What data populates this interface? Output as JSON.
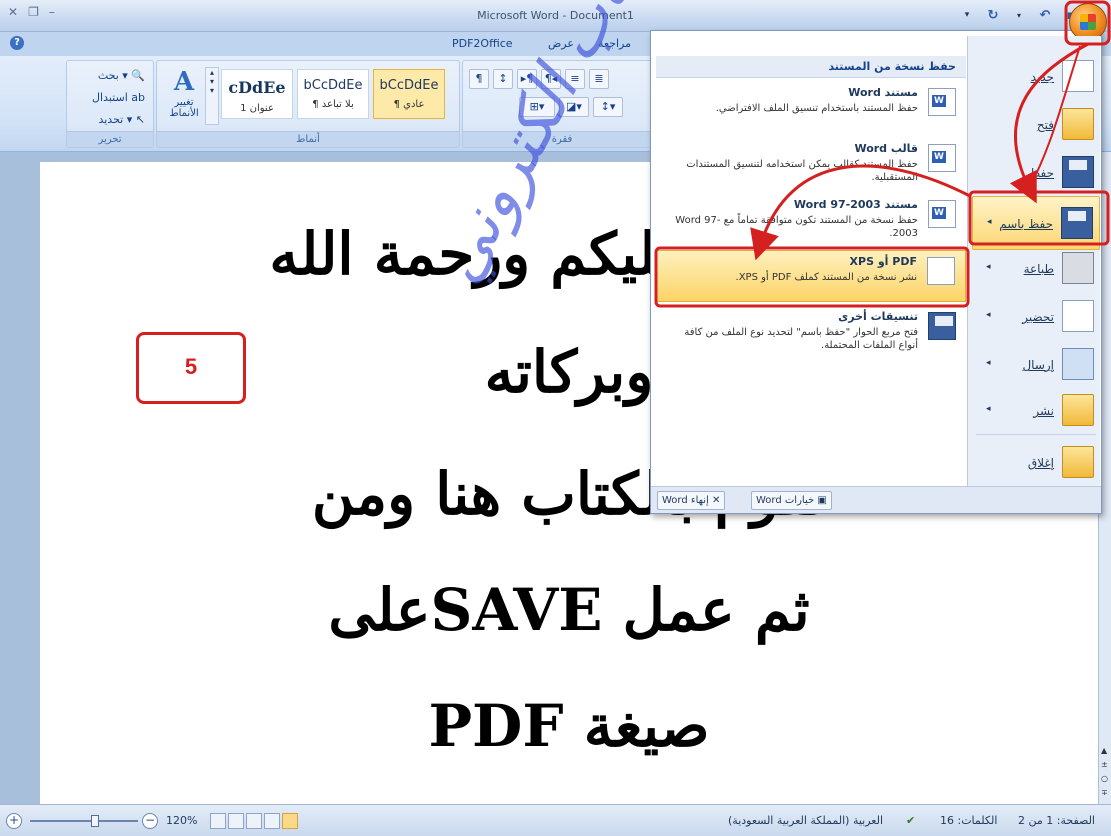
{
  "window": {
    "title": "Microsoft Word - Document1"
  },
  "ribbon": {
    "tabs": [
      "PDF2Office",
      "عرض",
      "مراجعة"
    ],
    "editing_group": {
      "label": "تحرير",
      "find": "بحث",
      "replace": "استبدال",
      "select": "تحديد"
    },
    "styles_group": {
      "label": "أنماط",
      "change_styles": "تغيير الأنماط",
      "styles": [
        {
          "sample": "cDdEe",
          "name": "عنوان 1"
        },
        {
          "sample": "bCcDdEe",
          "name": "¶ بلا تباعد"
        },
        {
          "sample": "bCcDdEe",
          "name": "¶ عادي"
        }
      ]
    },
    "paragraph_group": {
      "label": "فقرة"
    }
  },
  "office_menu": {
    "items": [
      {
        "label": "جديد",
        "icon": "new-document-icon",
        "has_submenu": false
      },
      {
        "label": "فتح",
        "icon": "open-folder-icon",
        "has_submenu": false
      },
      {
        "label": "حفظ",
        "icon": "save-icon",
        "has_submenu": false
      },
      {
        "label": "حفظ باسم",
        "icon": "save-as-icon",
        "has_submenu": true
      },
      {
        "label": "طباعة",
        "icon": "print-icon",
        "has_submenu": true
      },
      {
        "label": "تحضير",
        "icon": "prepare-icon",
        "has_submenu": true
      },
      {
        "label": "إرسال",
        "icon": "send-icon",
        "has_submenu": true
      },
      {
        "label": "نشر",
        "icon": "publish-icon",
        "has_submenu": true
      },
      {
        "label": "إغلاق",
        "icon": "close-folder-icon",
        "has_submenu": false
      }
    ],
    "submenu": {
      "header": "حفظ نسخة من المستند",
      "items": [
        {
          "title": "مستند Word",
          "desc": "حفظ المستند باستخدام تنسيق الملف الافتراضي."
        },
        {
          "title": "قالب Word",
          "desc": "حفظ المستند كقالب يمكن استخدامه لتنسيق المستندات المستقبلية."
        },
        {
          "title": "مستند Word 97-2003",
          "desc": "حفظ نسخة من المستند تكون متوافقة تماماً مع Word 97-2003."
        },
        {
          "title": "PDF أو XPS",
          "desc": "نشر نسخة من المستند كملف PDF أو XPS."
        },
        {
          "title": "تنسيقات أخرى",
          "desc": "فتح مربع الحوار \"حفظ باسم\" لتحديد نوع الملف من كافة أنواع الملفات المحتملة."
        }
      ]
    },
    "bottom": {
      "options": "خيارات Word",
      "exit": "إنهاء Word"
    }
  },
  "document": {
    "lines": [
      "السلام عليكم ورحمة الله",
      "وبركاته",
      "نقوم بالكتاب هنا ومن",
      "ثم عمل SAVEعلى",
      "صيغة PDF"
    ],
    "watermark": "عمل كتاب الكتروني",
    "step_number": "5"
  },
  "status_bar": {
    "page": "الصفحة: 1 من 2",
    "words": "الكلمات: 16",
    "language": "العربية (المملكة العربية السعودية)",
    "zoom": "120%",
    "zoom_fraction": 0.6
  },
  "colors": {
    "annotation_red": "#d62020",
    "menu_highlight": "#fcd773",
    "ribbon_blue": "#c9daf1"
  }
}
